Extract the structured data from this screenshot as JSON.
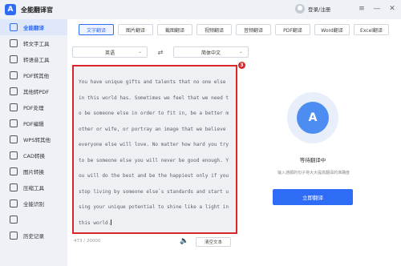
{
  "app": {
    "title": "全能翻译官",
    "logo_letter": "A"
  },
  "titlebar": {
    "login_label": "登录/注册",
    "menu_glyph": "≡",
    "minimize_glyph": "—",
    "close_glyph": "✕"
  },
  "sidebar": {
    "items": [
      {
        "label": "全能翻译",
        "icon": "translate-icon"
      },
      {
        "label": "转文字工具",
        "icon": "text-tool-icon"
      },
      {
        "label": "转语音工具",
        "icon": "voice-tool-icon"
      },
      {
        "label": "PDF转其他",
        "icon": "pdf-convert-icon"
      },
      {
        "label": "其他转PDF",
        "icon": "to-pdf-icon"
      },
      {
        "label": "PDF处理",
        "icon": "pdf-process-icon"
      },
      {
        "label": "PDF编辑",
        "icon": "pdf-edit-icon"
      },
      {
        "label": "WPS转其他",
        "icon": "wps-icon"
      },
      {
        "label": "CAD转换",
        "icon": "cad-icon"
      },
      {
        "label": "图片转换",
        "icon": "image-icon"
      },
      {
        "label": "压缩工具",
        "icon": "compress-icon"
      },
      {
        "label": "全能识别",
        "icon": "recognize-icon"
      },
      {
        "label": "",
        "icon": "more-icon"
      },
      {
        "label": "历史记录",
        "icon": "history-icon"
      }
    ]
  },
  "tabs": [
    "文字翻译",
    "图片翻译",
    "截图翻译",
    "视频翻译",
    "音频翻译",
    "PDF翻译",
    "Word翻译",
    "Excel翻译"
  ],
  "languages": {
    "source": "英语",
    "target": "简体中文",
    "swap_glyph": "⇄",
    "chevron": "⌄"
  },
  "editor": {
    "text": "You have unique gifts and talents that no one else in this world has. Sometimes we feel that we need to be someone else in order to fit in, be a better mother or wife, or portray an image that we believe everyone else will love. No matter how hard you try to be someone else you will never be good enough. You will do the best and be the happiest only if you stop living by someone else`s standards and start using your unique potential to shine like a light in this world.",
    "marker": "3",
    "char_count": "473 / 20000",
    "speaker_glyph": "🔈",
    "clear_label": "清空文本"
  },
  "right_panel": {
    "icon_letter": "A",
    "status": "等待翻译中",
    "hint": "输入通顺的句子将大大提高翻译的准确度",
    "translate_button": "立即翻译"
  },
  "colors": {
    "accent": "#2f6cf6",
    "highlight_border": "#d9262c"
  }
}
